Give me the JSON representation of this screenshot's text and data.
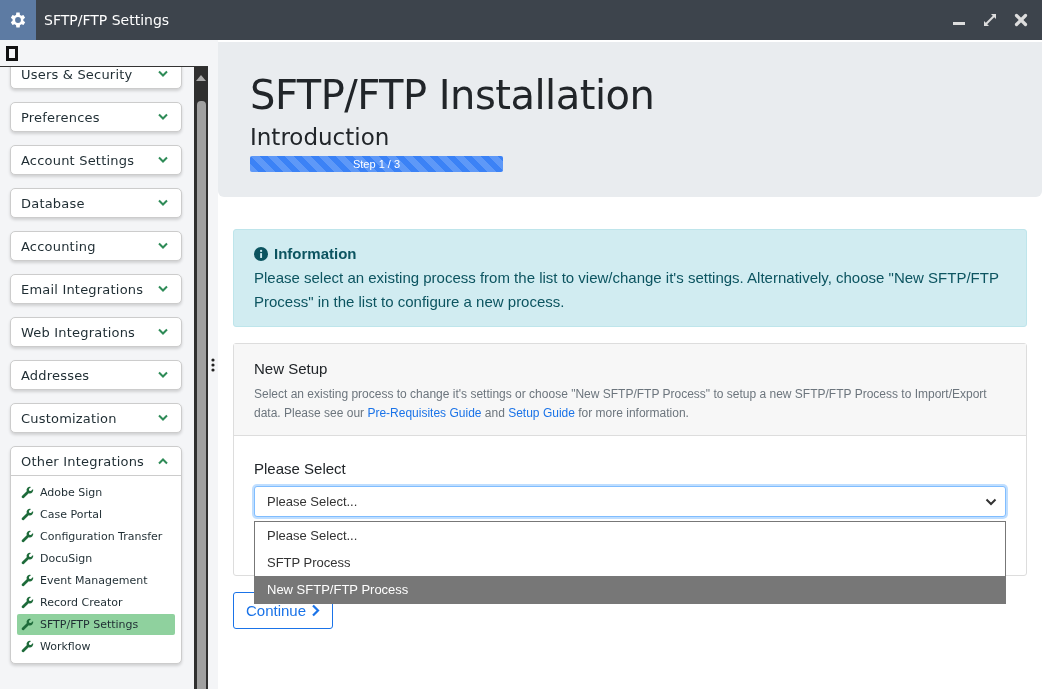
{
  "window": {
    "title": "SFTP/FTP Settings"
  },
  "sidebar": {
    "groups": [
      {
        "label": "Users & Security",
        "expanded": false
      },
      {
        "label": "Preferences",
        "expanded": false
      },
      {
        "label": "Account Settings",
        "expanded": false
      },
      {
        "label": "Database",
        "expanded": false
      },
      {
        "label": "Accounting",
        "expanded": false
      },
      {
        "label": "Email Integrations",
        "expanded": false
      },
      {
        "label": "Web Integrations",
        "expanded": false
      },
      {
        "label": "Addresses",
        "expanded": false
      },
      {
        "label": "Customization",
        "expanded": false
      },
      {
        "label": "Other Integrations",
        "expanded": true,
        "items": [
          {
            "label": "Adobe Sign",
            "selected": false
          },
          {
            "label": "Case Portal",
            "selected": false
          },
          {
            "label": "Configuration Transfer",
            "selected": false
          },
          {
            "label": "DocuSign",
            "selected": false
          },
          {
            "label": "Event Management",
            "selected": false
          },
          {
            "label": "Record Creator",
            "selected": false
          },
          {
            "label": "SFTP/FTP Settings",
            "selected": true
          },
          {
            "label": "Workflow",
            "selected": false
          }
        ]
      }
    ]
  },
  "header": {
    "title": "SFTP/FTP Installation",
    "subtitle": "Introduction",
    "progress": {
      "label": "Step 1 / 3",
      "level": 1
    }
  },
  "info": {
    "title": "Information",
    "text": "Please select an existing process from the list to view/change it's settings. Alternatively, choose \"New SFTP/FTP Process\" in the list to configure a new process."
  },
  "setup": {
    "title": "New Setup",
    "text_before": "Select an existing process to change it's settings or choose \"New SFTP/FTP Process\" to setup a new SFTP/FTP Process to Import/Export data. Please see our",
    "link_1": "Pre-Requisites Guide",
    "text_middle": "and",
    "link_2": "Setup Guide",
    "text_after": "for more information.",
    "select_label": "Please Select",
    "select_value": "Please Select...",
    "options": [
      {
        "label": "Please Select...",
        "selected": false
      },
      {
        "label": "SFTP Process",
        "selected": false
      },
      {
        "label": "New SFTP/FTP Process",
        "selected": true
      }
    ]
  },
  "continue_button": "Continue"
}
